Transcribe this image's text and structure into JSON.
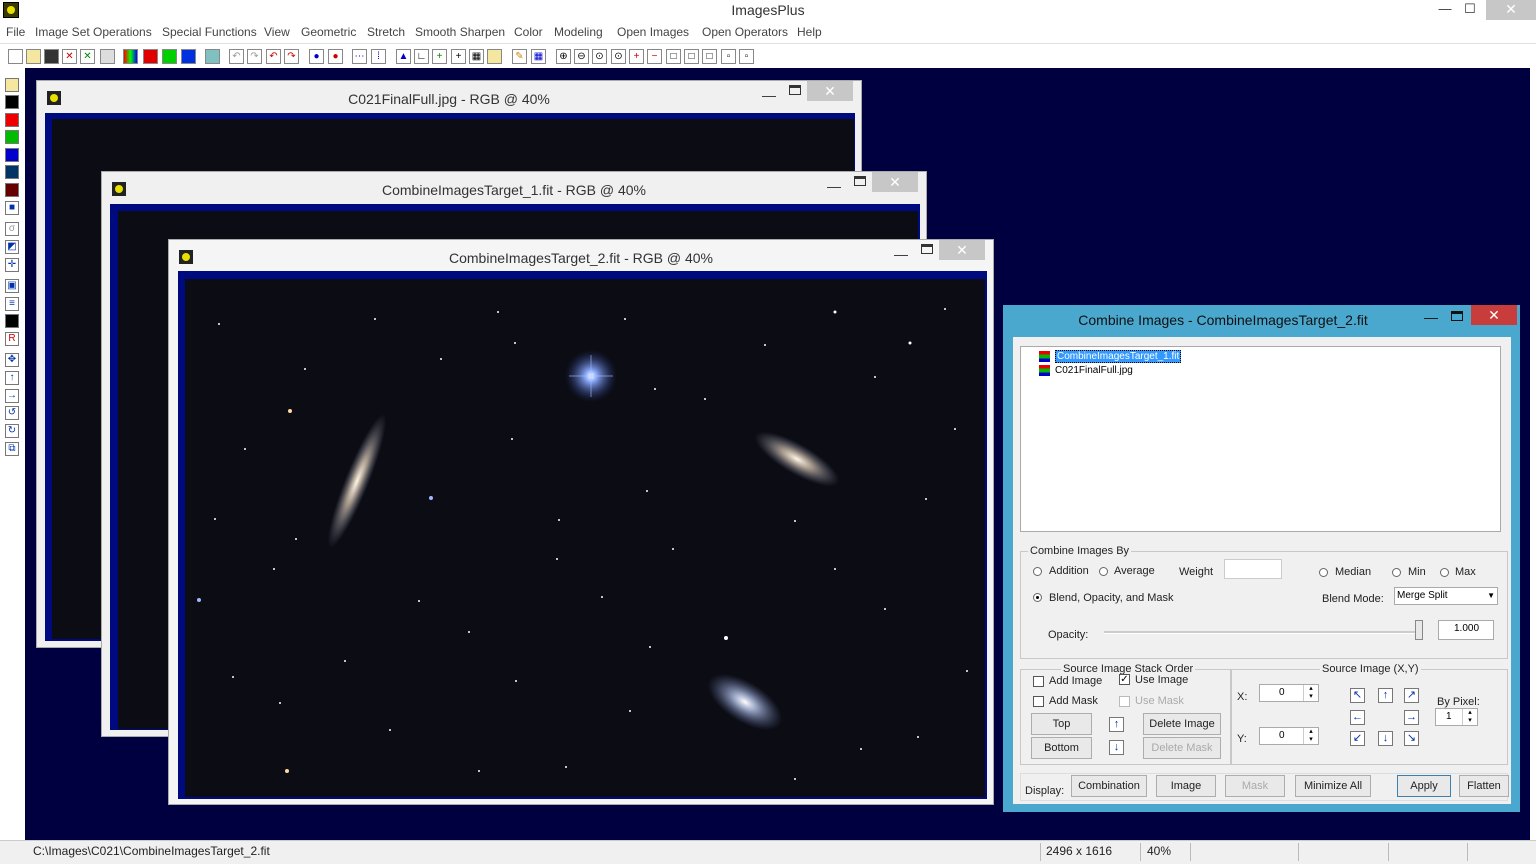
{
  "app": {
    "title": "ImagesPlus",
    "close_glyph": "✕",
    "min_glyph": "—",
    "max_glyph": "☐"
  },
  "menu": [
    "File",
    "Image Set Operations",
    "Special Functions",
    "View",
    "Geometric",
    "Stretch",
    "Smooth Sharpen",
    "Color",
    "Modeling",
    "Open Images",
    "Open Operators",
    "Help"
  ],
  "windows": {
    "win1": {
      "title": "C021FinalFull.jpg - RGB @ 40%"
    },
    "win2": {
      "title": "CombineImagesTarget_1.fit - RGB @ 40%"
    },
    "win3": {
      "title": "CombineImagesTarget_2.fit - RGB @ 40%"
    }
  },
  "dialog": {
    "title": "Combine Images - CombineImagesTarget_2.fit",
    "list": [
      "CombineImagesTarget_1.fit",
      "C021FinalFull.jpg"
    ],
    "combine_group": "Combine Images By",
    "addition": "Addition",
    "average": "Average",
    "weight": "Weight",
    "median": "Median",
    "min": "Min",
    "max": "Max",
    "blend": "Blend, Opacity, and Mask",
    "blend_mode_label": "Blend Mode:",
    "blend_mode_value": "Merge Split",
    "opacity_label": "Opacity:",
    "opacity_value": "1.000",
    "stack_group": "Source Image Stack Order",
    "add_image": "Add Image",
    "use_image": "Use Image",
    "add_mask": "Add Mask",
    "use_mask": "Use Mask",
    "top": "Top",
    "bottom": "Bottom",
    "delete_image": "Delete Image",
    "delete_mask": "Delete Mask",
    "source_group": "Source Image (X,Y)",
    "x_label": "X:",
    "y_label": "Y:",
    "x_value": "0",
    "y_value": "0",
    "by_pixel": "By Pixel:",
    "by_pixel_value": "1",
    "display_label": "Display:",
    "combination": "Combination",
    "image": "Image",
    "mask": "Mask",
    "minimize_all": "Minimize All",
    "apply": "Apply",
    "flatten": "Flatten",
    "check_glyph": "✓",
    "dropdown_glyph": "▼"
  },
  "status": {
    "path": "C:\\Images\\C021\\CombineImagesTarget_2.fit",
    "dimensions": "2496 x 1616",
    "zoom": "40%"
  },
  "colors": {
    "workspace": "#000040",
    "dialog_frame": "#4aa8cf",
    "image_border": "#000a80"
  }
}
